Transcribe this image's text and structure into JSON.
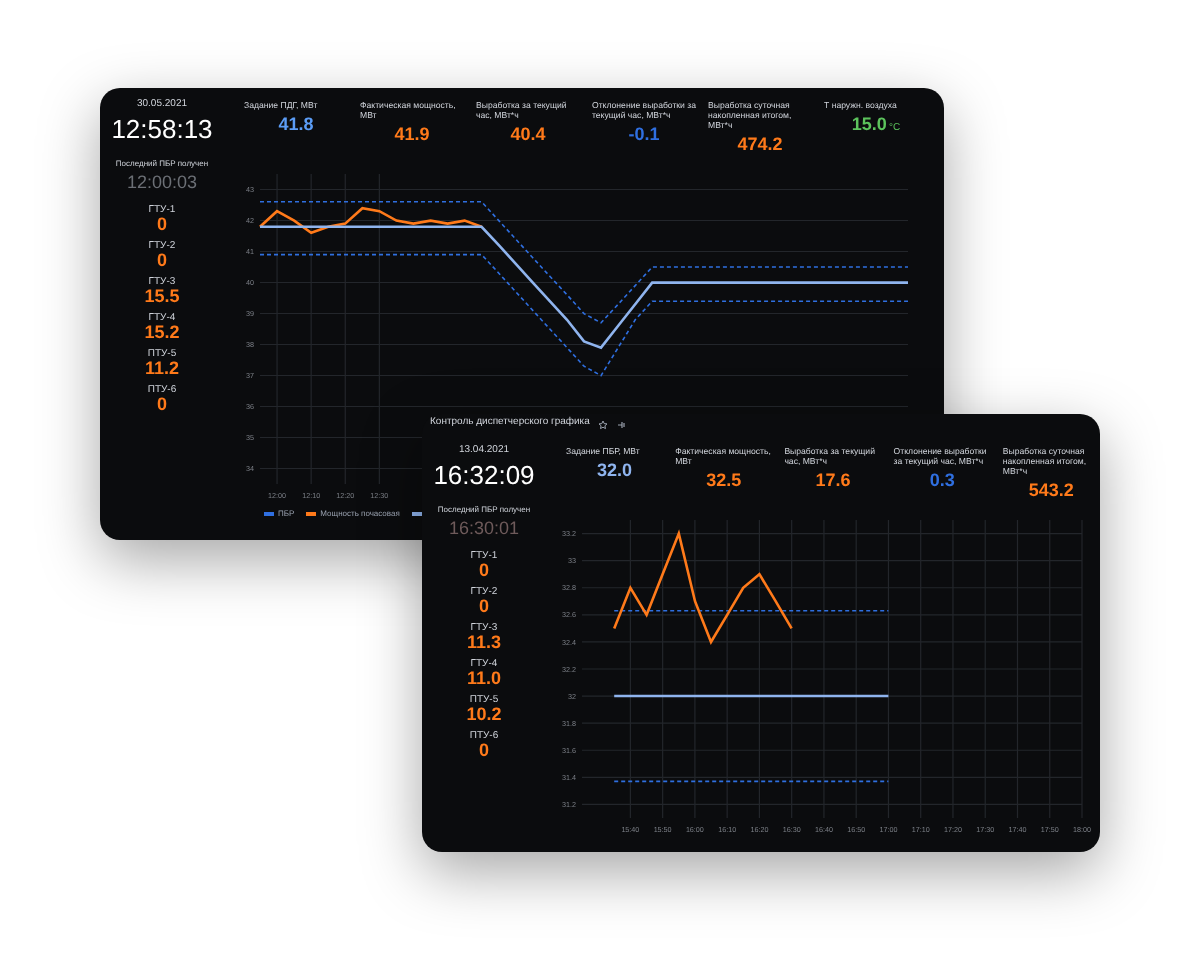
{
  "screens": [
    {
      "date": "30.05.2021",
      "time": "12:58:13",
      "last_label": "Последний ПБР получен",
      "last_time": "12:00:03",
      "metrics": [
        {
          "label": "Задание ПДГ, МВт",
          "value": "41.8",
          "color": "#5b9cf5"
        },
        {
          "label": "Фактическая мощность, МВт",
          "value": "41.9",
          "color": "#ff7a1a"
        },
        {
          "label": "Выработка за текущий час, МВт*ч",
          "value": "40.4",
          "color": "#ff7a1a"
        },
        {
          "label": "Отклонение выработки за текущий час, МВт*ч",
          "value": "-0.1",
          "color": "#2f6fe0"
        },
        {
          "label": "Выработка суточная накопленная итогом, МВт*ч",
          "value": "474.2",
          "color": "#ff7a1a"
        },
        {
          "label": "Т наружн. воздуха",
          "value": "15.0",
          "unit": "°C",
          "color": "#5cc35c"
        }
      ],
      "units": [
        {
          "name": "ГТУ-1",
          "value": "0"
        },
        {
          "name": "ГТУ-2",
          "value": "0"
        },
        {
          "name": "ГТУ-3",
          "value": "15.5"
        },
        {
          "name": "ГТУ-4",
          "value": "15.2"
        },
        {
          "name": "ПТУ-5",
          "value": "11.2"
        },
        {
          "name": "ПТУ-6",
          "value": "0"
        }
      ],
      "chart_data": {
        "type": "line",
        "categories": [
          null,
          "12:00",
          null,
          "12:10",
          null,
          "12:20",
          null,
          "12:30",
          null,
          null,
          null,
          null,
          null,
          null,
          null,
          null,
          null,
          null,
          null,
          null,
          null,
          null,
          null,
          null,
          null,
          null,
          null,
          null,
          null,
          null,
          null,
          null,
          null,
          null,
          null,
          null,
          null,
          null,
          null
        ],
        "ylim": [
          33.5,
          43.5
        ],
        "yticks": [
          34,
          35,
          36,
          37,
          38,
          39,
          40,
          41,
          42,
          43
        ],
        "grid": true,
        "series": [
          {
            "name": "ПБР",
            "color": "#2f6fe0",
            "line_style": "dashed",
            "values": [
              42.6,
              42.6,
              42.6,
              42.6,
              42.6,
              42.6,
              42.6,
              42.6,
              42.6,
              42.6,
              42.6,
              42.6,
              42.6,
              42.6,
              42.0,
              41.4,
              40.8,
              40.2,
              39.6,
              39.0,
              38.7,
              39.3,
              39.9,
              40.5,
              40.5,
              40.5,
              40.5,
              40.5,
              40.5,
              40.5,
              40.5,
              40.5,
              40.5,
              40.5,
              40.5,
              40.5,
              40.5,
              40.5,
              40.5
            ]
          },
          {
            "color": "#2f6fe0",
            "line_style": "dashed",
            "values": [
              40.9,
              40.9,
              40.9,
              40.9,
              40.9,
              40.9,
              40.9,
              40.9,
              40.9,
              40.9,
              40.9,
              40.9,
              40.9,
              40.9,
              40.3,
              39.7,
              39.1,
              38.5,
              37.9,
              37.3,
              37.0,
              37.9,
              38.8,
              39.4,
              39.4,
              39.4,
              39.4,
              39.4,
              39.4,
              39.4,
              39.4,
              39.4,
              39.4,
              39.4,
              39.4,
              39.4,
              39.4,
              39.4,
              39.4
            ]
          },
          {
            "name": "Мощность почасовая",
            "color": "#ff7a1a",
            "line_style": "solid",
            "values": [
              41.8,
              42.3,
              42.0,
              41.6,
              41.8,
              41.9,
              42.4,
              42.3,
              42.0,
              41.9,
              42.0,
              41.9,
              42.0,
              41.8,
              null,
              null,
              null,
              null,
              null,
              null,
              null,
              null,
              null,
              null,
              null,
              null,
              null,
              null,
              null,
              null,
              null,
              null,
              null,
              null,
              null,
              null,
              null,
              null,
              null
            ]
          },
          {
            "color": "#8fb4ee",
            "line_style": "solid",
            "values": [
              41.8,
              41.8,
              41.8,
              41.8,
              41.8,
              41.8,
              41.8,
              41.8,
              41.8,
              41.8,
              41.8,
              41.8,
              41.8,
              41.8,
              41.2,
              40.6,
              40.0,
              39.4,
              38.8,
              38.1,
              37.9,
              38.6,
              39.3,
              40.0,
              40.0,
              40.0,
              40.0,
              40.0,
              40.0,
              40.0,
              40.0,
              40.0,
              40.0,
              40.0,
              40.0,
              40.0,
              40.0,
              40.0,
              40.0
            ]
          }
        ]
      }
    },
    {
      "title": "Контроль диспетчерского графика",
      "date": "13.04.2021",
      "time": "16:32:09",
      "last_label": "Последний ПБР получен",
      "last_time": "16:30:01",
      "metrics": [
        {
          "label": "Задание ПБР, МВт",
          "value": "32.0",
          "color": "#8fb4ee"
        },
        {
          "label": "Фактическая мощность, МВт",
          "value": "32.5",
          "color": "#ff7a1a"
        },
        {
          "label": "Выработка за текущий час, МВт*ч",
          "value": "17.6",
          "color": "#ff7a1a"
        },
        {
          "label": "Отклонение выработки за текущий час, МВт*ч",
          "value": "0.3",
          "color": "#2f6fe0"
        },
        {
          "label": "Выработка суточная накопленная итогом, МВт*ч",
          "value": "543.2",
          "color": "#ff7a1a"
        }
      ],
      "units": [
        {
          "name": "ГТУ-1",
          "value": "0"
        },
        {
          "name": "ГТУ-2",
          "value": "0"
        },
        {
          "name": "ГТУ-3",
          "value": "11.3"
        },
        {
          "name": "ГТУ-4",
          "value": "11.0"
        },
        {
          "name": "ПТУ-5",
          "value": "10.2"
        },
        {
          "name": "ПТУ-6",
          "value": "0"
        }
      ],
      "chart_data": {
        "type": "line",
        "categories": [
          null,
          null,
          null,
          "15:40",
          null,
          "15:50",
          null,
          "16:00",
          null,
          "16:10",
          null,
          "16:20",
          null,
          "16:30",
          null,
          "16:40",
          null,
          "16:50",
          null,
          "17:00",
          null,
          "17:10",
          null,
          "17:20",
          null,
          "17:30",
          null,
          "17:40",
          null,
          "17:50",
          null,
          "18:00"
        ],
        "ylim": [
          31.1,
          33.3
        ],
        "yticks": [
          31.2,
          31.4,
          31.6,
          31.8,
          32,
          32.2,
          32.4,
          32.6,
          32.8,
          33,
          33.2
        ],
        "grid": true,
        "series": [
          {
            "color": "#2f6fe0",
            "line_style": "dashed",
            "values": [
              null,
              null,
              32.63,
              32.63,
              32.63,
              32.63,
              32.63,
              32.63,
              32.63,
              32.63,
              32.63,
              32.63,
              32.63,
              32.63,
              32.63,
              32.63,
              32.63,
              32.63,
              32.63,
              32.63,
              null,
              null,
              null,
              null,
              null,
              null,
              null,
              null,
              null,
              null,
              null,
              null
            ]
          },
          {
            "color": "#2f6fe0",
            "line_style": "dashed",
            "values": [
              null,
              null,
              31.37,
              31.37,
              31.37,
              31.37,
              31.37,
              31.37,
              31.37,
              31.37,
              31.37,
              31.37,
              31.37,
              31.37,
              31.37,
              31.37,
              31.37,
              31.37,
              31.37,
              31.37,
              null,
              null,
              null,
              null,
              null,
              null,
              null,
              null,
              null,
              null,
              null,
              null
            ]
          },
          {
            "color": "#ff7a1a",
            "line_style": "solid",
            "values": [
              null,
              null,
              32.5,
              32.8,
              32.6,
              32.9,
              33.2,
              32.7,
              32.4,
              32.6,
              32.8,
              32.9,
              32.7,
              32.5,
              null,
              null,
              null,
              null,
              null,
              null,
              null,
              null,
              null,
              null,
              null,
              null,
              null,
              null,
              null,
              null,
              null,
              null
            ]
          },
          {
            "color": "#8fb4ee",
            "line_style": "solid",
            "values": [
              null,
              null,
              32,
              32,
              32,
              32,
              32,
              32,
              32,
              32,
              32,
              32,
              32,
              32,
              32,
              32,
              32,
              32,
              32,
              32,
              null,
              null,
              null,
              null,
              null,
              null,
              null,
              null,
              null,
              null,
              null,
              null
            ]
          }
        ]
      }
    }
  ]
}
